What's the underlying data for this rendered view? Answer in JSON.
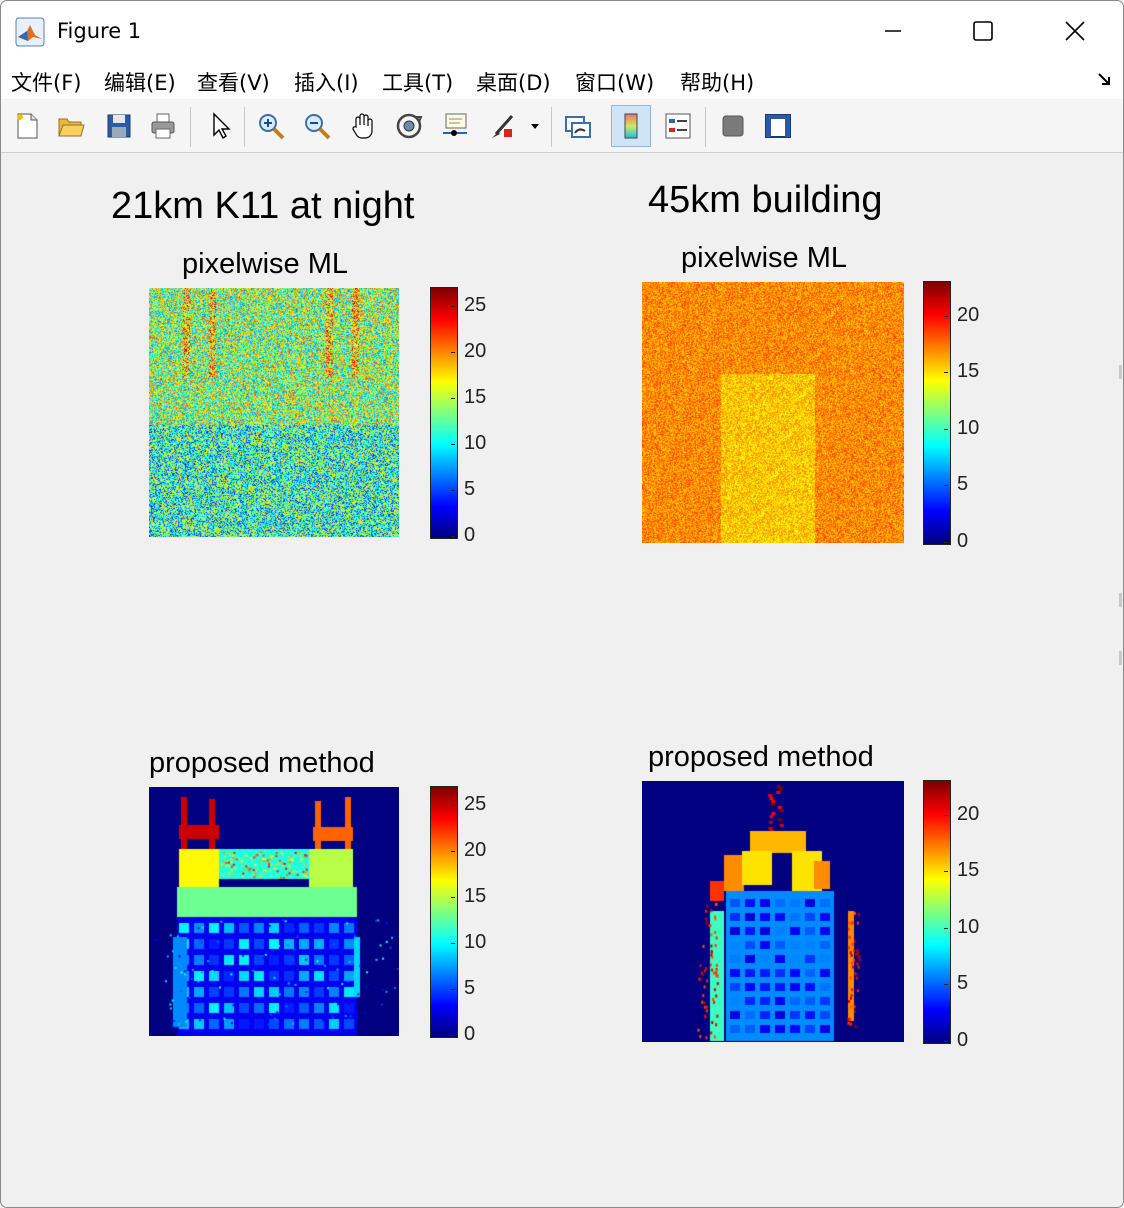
{
  "window": {
    "title": "Figure 1",
    "buttons": [
      "minimize",
      "maximize",
      "close"
    ]
  },
  "menu": [
    {
      "label": "文件(F)"
    },
    {
      "label": "编辑(E)"
    },
    {
      "label": "查看(V)"
    },
    {
      "label": "插入(I)"
    },
    {
      "label": "工具(T)"
    },
    {
      "label": "桌面(D)"
    },
    {
      "label": "窗口(W)"
    },
    {
      "label": "帮助(H)"
    }
  ],
  "toolbar": {
    "buttons": [
      "new-figure-icon",
      "open-file-icon",
      "save-icon",
      "print-icon",
      "pointer-icon",
      "zoom-in-icon",
      "zoom-out-icon",
      "pan-icon",
      "rotate-3d-icon",
      "data-cursor-icon",
      "brush-icon",
      "link-plot-icon",
      "colorbar-icon",
      "legend-icon",
      "hide-plot-tools-icon",
      "show-plot-tools-icon"
    ],
    "active": "colorbar-icon"
  },
  "figure": {
    "suptitles": [
      "21km K11 at night",
      "45km building"
    ],
    "colormap": "jet",
    "panels": [
      {
        "title": "pixelwise ML",
        "cbar_ticks": [
          "25",
          "20",
          "15",
          "10",
          "5",
          "0"
        ],
        "clim": [
          0,
          27
        ]
      },
      {
        "title": "pixelwise ML",
        "cbar_ticks": [
          "20",
          "15",
          "10",
          "5",
          "0"
        ],
        "clim": [
          0,
          23
        ]
      },
      {
        "title": "proposed method",
        "cbar_ticks": [
          "25",
          "20",
          "15",
          "10",
          "5",
          "0"
        ],
        "clim": [
          0,
          27
        ]
      },
      {
        "title": "proposed method",
        "cbar_ticks": [
          "20",
          "15",
          "10",
          "5",
          "0"
        ],
        "clim": [
          0,
          23
        ]
      }
    ]
  }
}
